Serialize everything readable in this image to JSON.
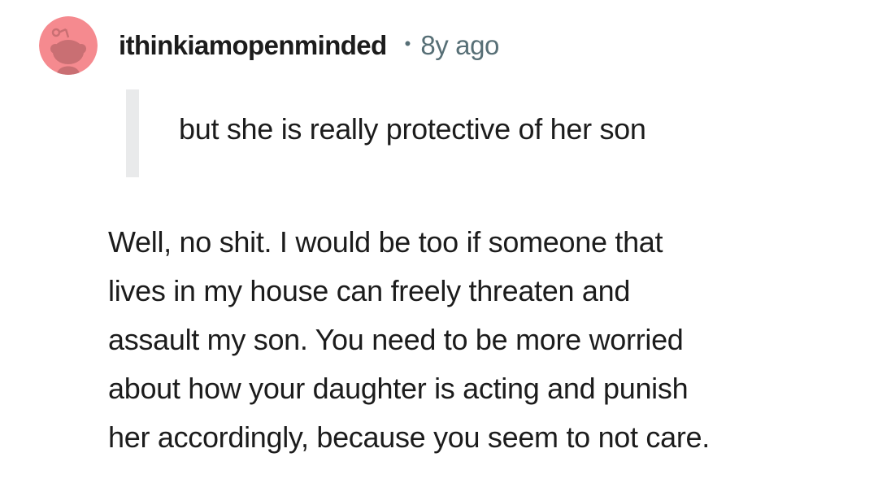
{
  "comment": {
    "avatar_icon": "snoo-avatar-icon",
    "avatar_bg_color": "#f58a8f",
    "username": "ithinkiamopenminded",
    "separator": "•",
    "timestamp": "8y ago",
    "quote": "but she is really protective of her son",
    "body_lines": [
      "Well, no shit. I would be too if someone that",
      "lives in my house can freely threaten and",
      "assault my son. You need to be more worried",
      "about how your daughter is acting and punish",
      "her accordingly, because you seem to not care."
    ]
  }
}
